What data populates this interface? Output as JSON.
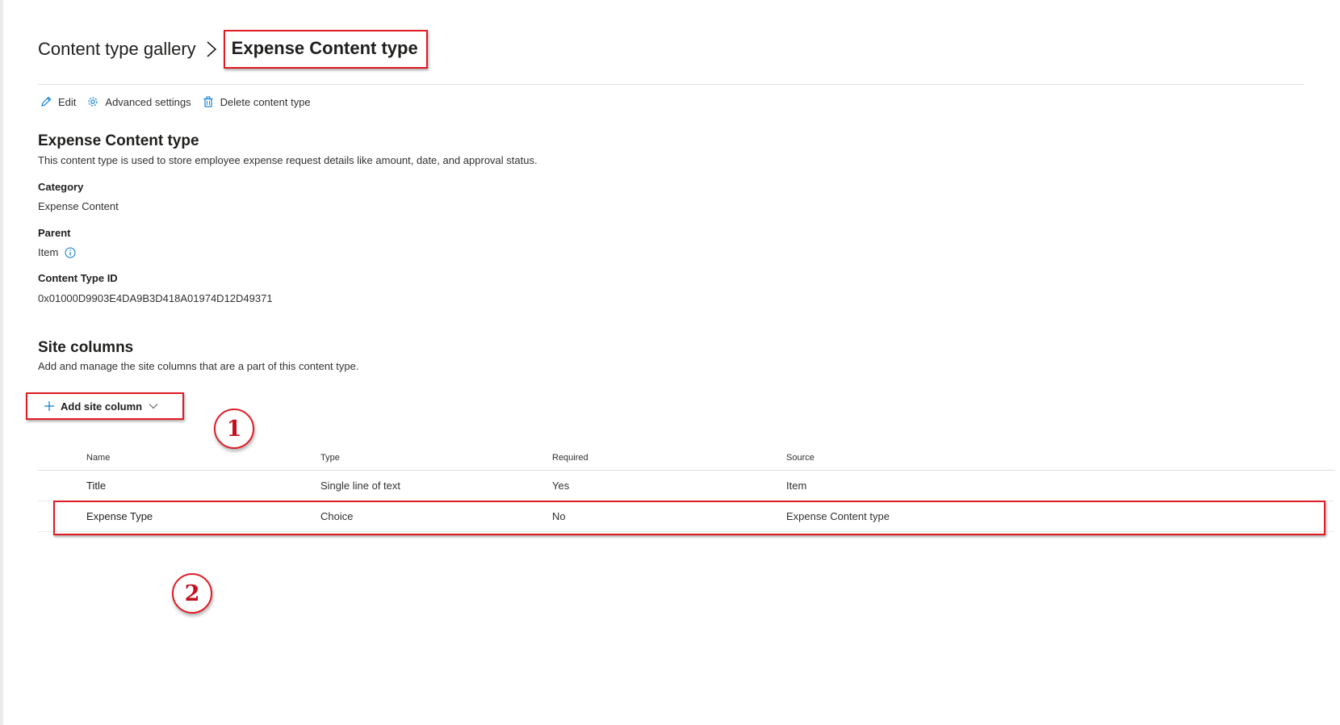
{
  "breadcrumb": {
    "root": "Content type gallery",
    "current": "Expense Content type"
  },
  "command_bar": {
    "edit": "Edit",
    "advanced_settings": "Advanced settings",
    "delete": "Delete content type"
  },
  "details": {
    "title": "Expense Content type",
    "description": "This content type is used to store employee expense request details like amount, date, and approval status.",
    "category_label": "Category",
    "category_value": "Expense Content",
    "parent_label": "Parent",
    "parent_value": "Item",
    "id_label": "Content Type ID",
    "id_value": "0x01000D9903E4DA9B3D418A01974D12D49371"
  },
  "site_columns": {
    "title": "Site columns",
    "description": "Add and manage the site columns that are a part of this content type.",
    "add_button": "Add site column",
    "headers": {
      "name": "Name",
      "type": "Type",
      "required": "Required",
      "source": "Source"
    },
    "rows": [
      {
        "name": "Title",
        "type": "Single line of text",
        "required": "Yes",
        "source": "Item"
      },
      {
        "name": "Expense Type",
        "type": "Choice",
        "required": "No",
        "source": "Expense Content type"
      }
    ]
  },
  "annotations": {
    "step1": "1",
    "step2": "2"
  },
  "colors": {
    "highlight": "#e01b24",
    "accent": "#0078d4"
  },
  "icons": [
    "chevron-right-icon",
    "edit-icon",
    "gear-icon",
    "trash-icon",
    "info-icon",
    "plus-icon",
    "chevron-down-icon"
  ]
}
